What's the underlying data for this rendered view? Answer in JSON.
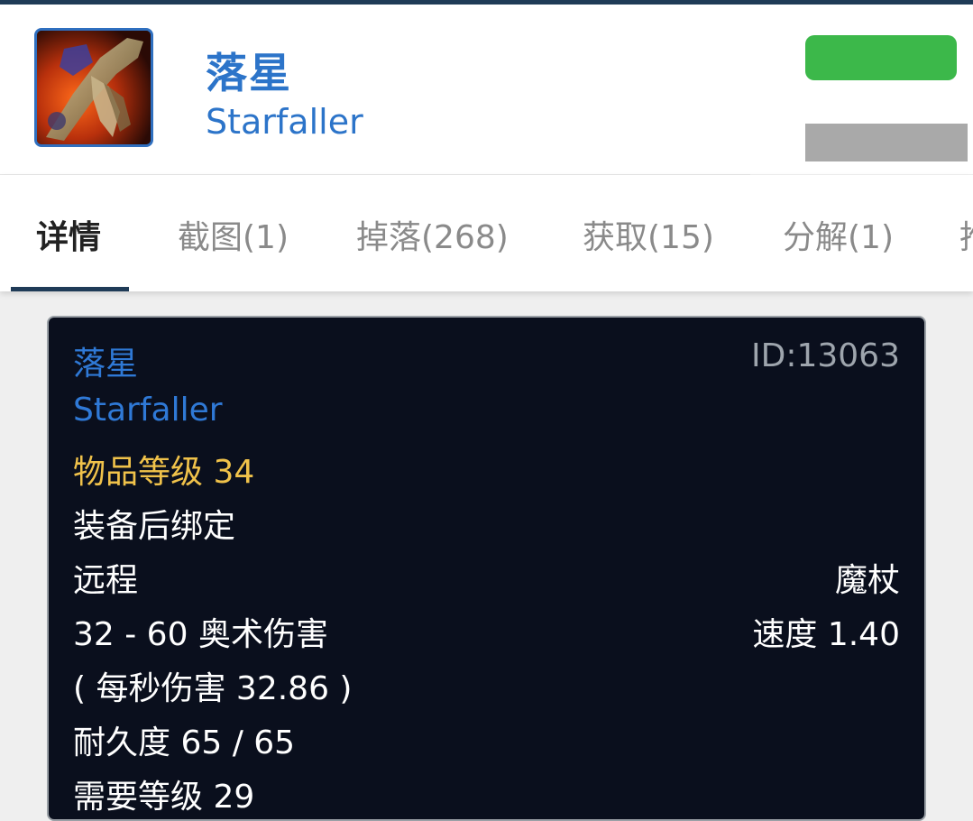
{
  "item": {
    "name_cn": "落星",
    "name_en": "Starfaller",
    "icon": "staff-item-icon"
  },
  "tabs": [
    {
      "label": "详情",
      "active": true
    },
    {
      "label": "截图(1)",
      "active": false
    },
    {
      "label": "掉落(268)",
      "active": false
    },
    {
      "label": "获取(15)",
      "active": false
    },
    {
      "label": "分解(1)",
      "active": false
    },
    {
      "label": "推",
      "active": false
    }
  ],
  "tooltip": {
    "name_cn": "落星",
    "id": "ID:13063",
    "name_en": "Starfaller",
    "item_level": "物品等级 34",
    "binding": "装备后绑定",
    "slot": "远程",
    "weapon_type": "魔杖",
    "damage": "32 - 60 奥术伤害",
    "speed": "速度 1.40",
    "dps": "( 每秒伤害 32.86 )",
    "durability": "耐久度 65 / 65",
    "required_level": "需要等级 29"
  },
  "colors": {
    "accent_blue": "#2c74c9",
    "item_level_gold": "#f0c24a",
    "tooltip_bg": "#0a0f1d",
    "green_badge": "#3cb84a"
  }
}
